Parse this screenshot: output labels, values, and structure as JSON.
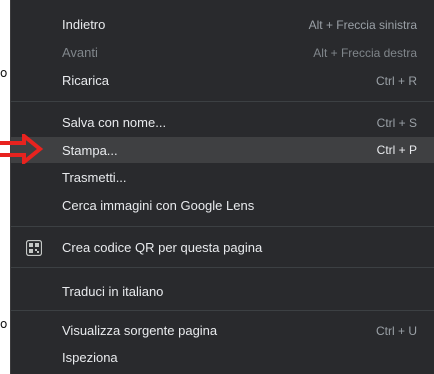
{
  "background": {
    "fragments": [
      "o",
      "o"
    ]
  },
  "menu": {
    "items": [
      {
        "label": "Indietro",
        "shortcut": "Alt + Freccia sinistra",
        "icon": "",
        "state": "normal"
      },
      {
        "label": "Avanti",
        "shortcut": "Alt + Freccia destra",
        "icon": "",
        "state": "disabled"
      },
      {
        "label": "Ricarica",
        "shortcut": "Ctrl + R",
        "icon": "",
        "state": "normal"
      },
      {
        "label": "Salva con nome...",
        "shortcut": "Ctrl + S",
        "icon": "",
        "state": "normal"
      },
      {
        "label": "Stampa...",
        "shortcut": "Ctrl + P",
        "icon": "",
        "state": "active"
      },
      {
        "label": "Trasmetti...",
        "shortcut": "",
        "icon": "",
        "state": "normal"
      },
      {
        "label": "Cerca immagini con Google Lens",
        "shortcut": "",
        "icon": "",
        "state": "normal"
      },
      {
        "label": "Crea codice QR per questa pagina",
        "shortcut": "",
        "icon": "qr-code-icon",
        "state": "normal"
      },
      {
        "label": "Traduci in italiano",
        "shortcut": "",
        "icon": "",
        "state": "normal"
      },
      {
        "label": "Visualizza sorgente pagina",
        "shortcut": "Ctrl + U",
        "icon": "",
        "state": "normal"
      },
      {
        "label": "Ispeziona",
        "shortcut": "",
        "icon": "",
        "state": "normal"
      }
    ]
  },
  "annotation": {
    "icon": "red-arrow-icon",
    "color": "#e8231f"
  },
  "colors": {
    "menu_background": "#292a2d",
    "menu_highlight": "#3f4042",
    "text": "#e8eaed",
    "shortcut_text": "#9aa0a6",
    "disabled_text": "#80868b",
    "separator": "#3c4043"
  }
}
